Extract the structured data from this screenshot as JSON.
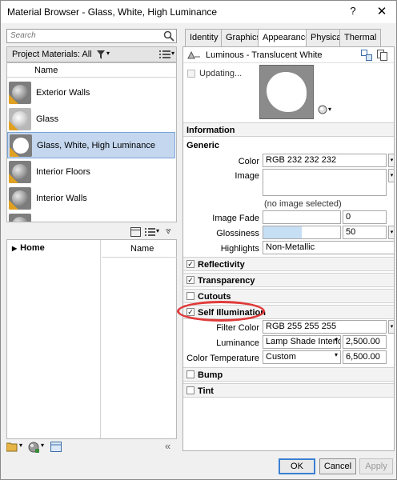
{
  "window": {
    "title": "Material Browser - Glass, White, High Luminance",
    "help": "?",
    "close": "✕"
  },
  "search": {
    "placeholder": "Search"
  },
  "project": {
    "label": "Project Materials: All",
    "column_name": "Name",
    "materials": [
      {
        "label": "Exterior Walls",
        "thumb": "gray-sphere"
      },
      {
        "label": "Glass",
        "thumb": "glass-sphere"
      },
      {
        "label": "Glass, White, High Luminance",
        "thumb": "white-sphere",
        "selected": true
      },
      {
        "label": "Interior Floors",
        "thumb": "gray-sphere"
      },
      {
        "label": "Interior Walls",
        "thumb": "gray-sphere"
      }
    ]
  },
  "library": {
    "home": "Home",
    "column_name": "Name"
  },
  "tabs": [
    "Identity",
    "Graphics",
    "Appearance",
    "Physical",
    "Thermal"
  ],
  "active_tab": "Appearance",
  "asset": {
    "name": "Luminous - Translucent White",
    "updating": "Updating..."
  },
  "sections": {
    "information": "Information",
    "generic": "Generic",
    "reflectivity": "Reflectivity",
    "transparency": "Transparency",
    "cutouts": "Cutouts",
    "self_illumination": "Self Illumination",
    "bump": "Bump",
    "tint": "Tint"
  },
  "generic": {
    "color_label": "Color",
    "color_value": "RGB 232 232 232",
    "image_label": "Image",
    "image_note": "(no image selected)",
    "image_fade_label": "Image Fade",
    "image_fade_value": "0",
    "glossiness_label": "Glossiness",
    "glossiness_value": "50",
    "highlights_label": "Highlights",
    "highlights_value": "Non-Metallic"
  },
  "self_illum": {
    "filter_color_label": "Filter Color",
    "filter_color_value": "RGB 255 255 255",
    "luminance_label": "Luminance",
    "luminance_value": "Lamp Shade Interior",
    "luminance_number": "2,500.00",
    "color_temp_label": "Color Temperature",
    "color_temp_value": "Custom",
    "color_temp_number": "6,500.00"
  },
  "checks": {
    "reflectivity": true,
    "transparency": true,
    "cutouts": false,
    "self_illumination": true,
    "bump": false,
    "tint": false
  },
  "buttons": {
    "ok": "OK",
    "cancel": "Cancel",
    "apply": "Apply"
  },
  "colors": {
    "selection": "#c4d7ef",
    "annotation": "#e03a3a",
    "accent": "#3c7fd4"
  }
}
